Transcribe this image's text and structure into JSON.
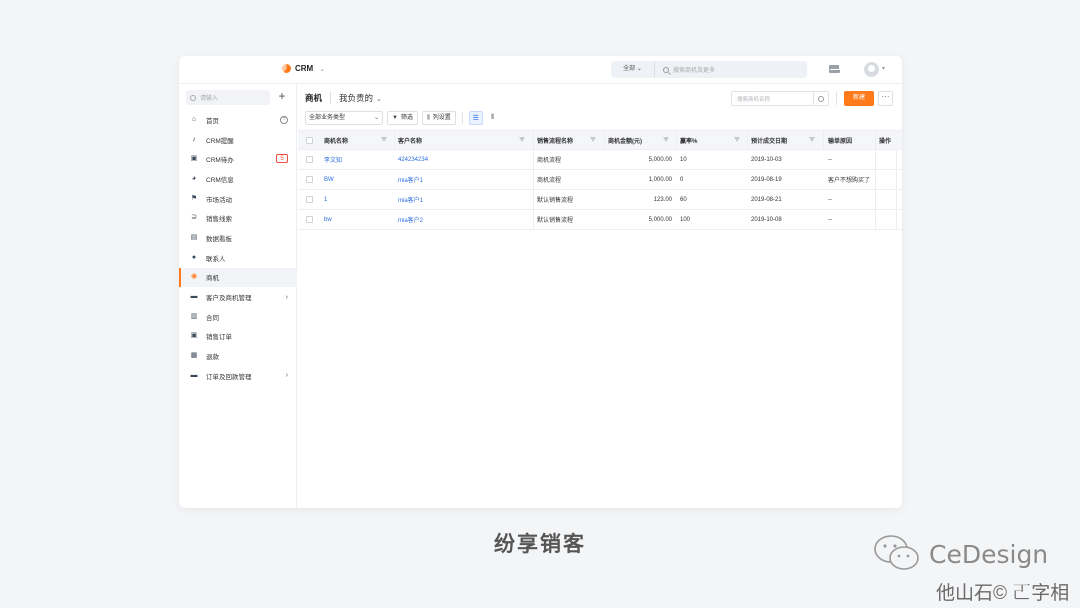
{
  "app": {
    "name": "CRM"
  },
  "search": {
    "scope": "全部",
    "placeholder": "搜索商机及更多"
  },
  "sidebar": {
    "search_placeholder": "请输入",
    "add": "+",
    "items": [
      {
        "label": "首页",
        "icon": "home-icon"
      },
      {
        "label": "CRM提醒",
        "icon": "bell-icon"
      },
      {
        "label": "CRM待办",
        "icon": "todo-icon",
        "badge": "5"
      },
      {
        "label": "CRM信息",
        "icon": "pie-icon"
      },
      {
        "label": "市场活动",
        "icon": "flag-icon"
      },
      {
        "label": "销售线索",
        "icon": "leads-icon"
      },
      {
        "label": "数据看板",
        "icon": "dashboard-icon"
      },
      {
        "label": "联系人",
        "icon": "contact-icon"
      },
      {
        "label": "商机",
        "icon": "target-icon"
      },
      {
        "label": "客户及商机管理",
        "icon": "folder-icon"
      },
      {
        "label": "合同",
        "icon": "contract-icon"
      },
      {
        "label": "销售订单",
        "icon": "order-icon"
      },
      {
        "label": "退款",
        "icon": "refund-icon"
      },
      {
        "label": "订单及回款管理",
        "icon": "folder-icon"
      }
    ]
  },
  "main": {
    "title": "商机",
    "scope": "我负责的",
    "search_placeholder": "搜索商机名称",
    "new_label": "新建",
    "more_label": "···",
    "type_select": "全部业务类型",
    "filter_label": "筛选",
    "columns_label": "列设置"
  },
  "table": {
    "headers": [
      "商机名称",
      "客户名称",
      "销售流程名称",
      "商机金额(元)",
      "赢率%",
      "预计成交日期",
      "输单原因",
      "操作"
    ],
    "rows": [
      [
        "李文知",
        "424234234",
        "商机流程",
        "5,000.00",
        "10",
        "2019-10-03",
        "--"
      ],
      [
        "BW",
        "mia客户1",
        "商机流程",
        "1,000.00",
        "0",
        "2019-08-19",
        "客户不想购买了"
      ],
      [
        "1",
        "mia客户1",
        "默认销售流程",
        "123.00",
        "60",
        "2019-08-21",
        "--"
      ],
      [
        "bw",
        "mia客户2",
        "默认销售流程",
        "5,000.00",
        "100",
        "2019-10-08",
        "--"
      ]
    ]
  },
  "caption": "纷享销客",
  "watermark": {
    "title": "CeDesign",
    "sub": "他山石© 𠀀字相"
  },
  "colors": {
    "accent": "#ff7a1a",
    "link": "#2b6de0",
    "badge": "#f04c3c"
  }
}
